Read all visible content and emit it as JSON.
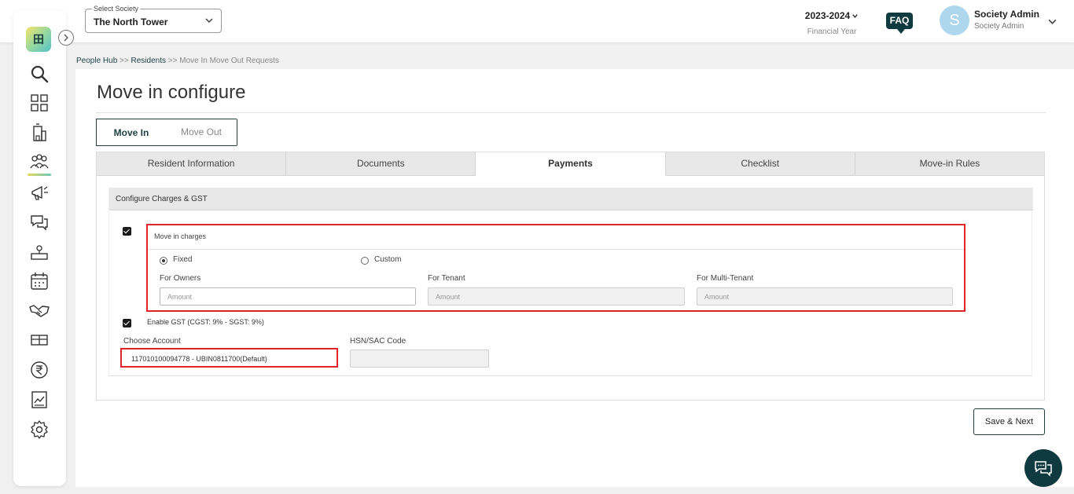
{
  "header": {
    "society_label": "Select Society",
    "society_value": "The North Tower",
    "financial_year": "2023-2024",
    "financial_year_caption": "Financial Year",
    "faq": "FAQ",
    "avatar_initial": "S",
    "user_name": "Society Admin",
    "user_role": "Society Admin"
  },
  "sidebar": {
    "logo_text": "田",
    "items": [
      "search-icon",
      "dashboard-icon",
      "building-icon",
      "people-icon",
      "campaign-icon",
      "chat-icon",
      "services-icon",
      "calendar-icon",
      "handshake-icon",
      "amenities-icon",
      "rupee-icon",
      "reports-icon",
      "settings-icon"
    ],
    "active_item": "people-icon"
  },
  "breadcrumb": {
    "level1": "People Hub",
    "sep1": ">>",
    "level2": "Residents",
    "sep2": ">>",
    "level3": "Move In Move Out Requests"
  },
  "page": {
    "title": "Move in configure",
    "toggle": [
      "Move In",
      "Move Out"
    ],
    "active_toggle": "Move In",
    "tabs": [
      "Resident Information",
      "Documents",
      "Payments",
      "Checklist",
      "Move-in Rules"
    ],
    "active_tab": "Payments"
  },
  "payments": {
    "section_title": "Configure Charges & GST",
    "move_in_charges": {
      "checked": true,
      "title": "Move in charges",
      "options": [
        "Fixed",
        "Custom"
      ],
      "selected": "Fixed",
      "fields": [
        {
          "label": "For Owners",
          "placeholder": "Amount",
          "disabled": false
        },
        {
          "label": "For Tenant",
          "placeholder": "Amount",
          "disabled": true
        },
        {
          "label": "For Multi-Tenant",
          "placeholder": "Amount",
          "disabled": true
        }
      ]
    },
    "gst": {
      "checked": true,
      "label": "Enable GST (CGST: 9% - SGST: 9%)"
    },
    "account": {
      "label": "Choose Account",
      "value": "117010100094778 - UBIN0811700(Default)"
    },
    "hsn": {
      "label": "HSN/SAC Code",
      "value": ""
    }
  },
  "actions": {
    "save_next": "Save & Next"
  },
  "colors": {
    "brand_dark": "#0f3b40",
    "highlight_red": "#e0242b",
    "tab_bg": "#e8e8e8"
  }
}
